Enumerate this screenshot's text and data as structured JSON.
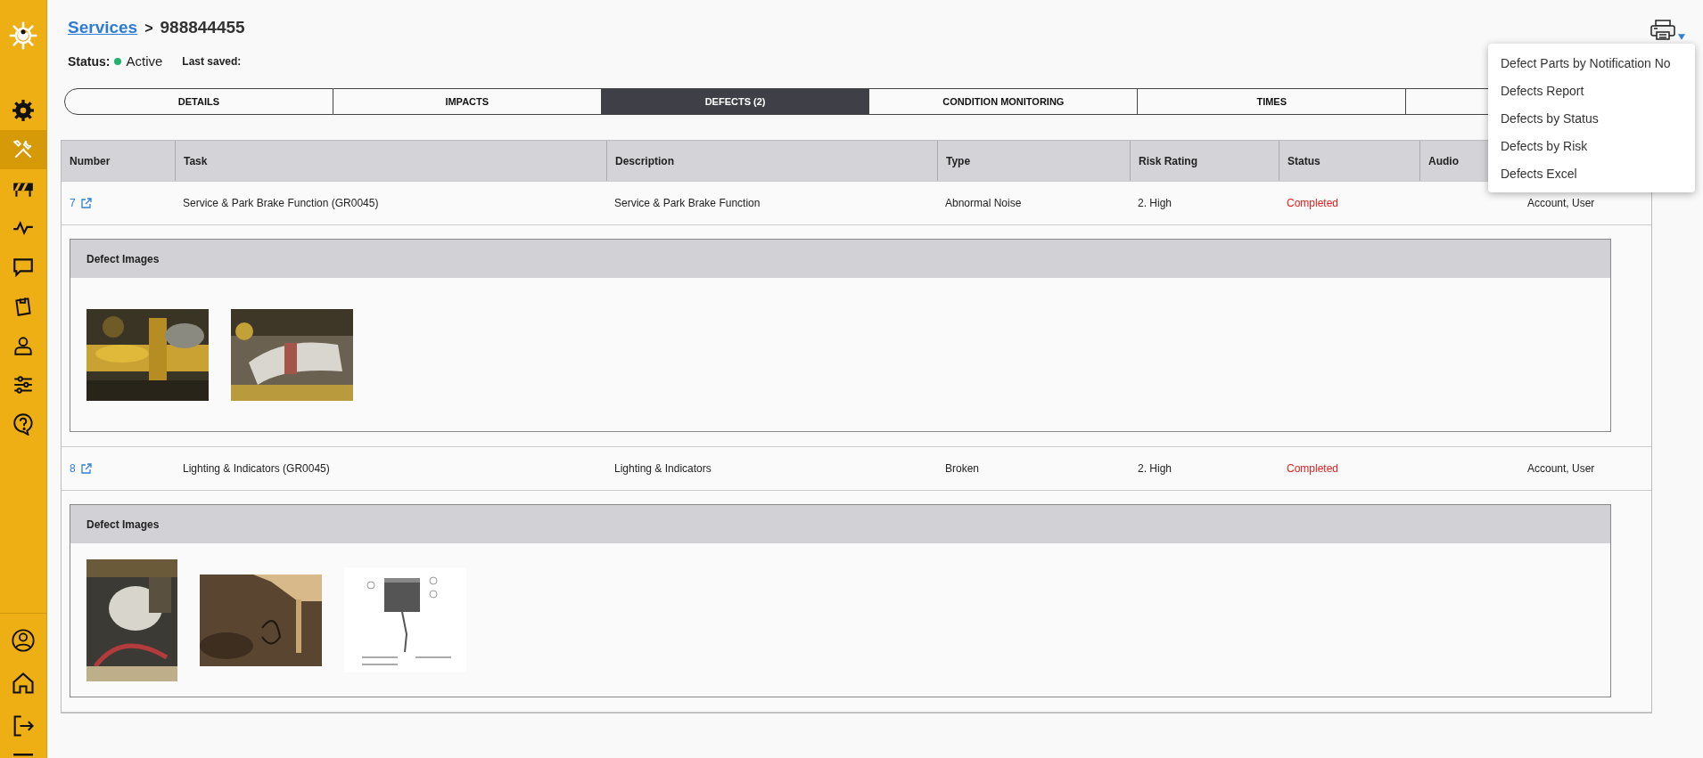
{
  "sidebar": {
    "items": [
      {
        "selected": false
      },
      {
        "selected": true
      },
      {
        "selected": false
      },
      {
        "selected": false
      },
      {
        "selected": false
      },
      {
        "selected": false
      },
      {
        "selected": false
      },
      {
        "selected": false
      },
      {
        "selected": false
      }
    ]
  },
  "breadcrumb": {
    "link": "Services",
    "separator": ">",
    "current": "988844455"
  },
  "status": {
    "label": "Status:",
    "value": "Active",
    "last_saved_label": "Last saved:"
  },
  "tabs": [
    {
      "label": "DETAILS",
      "selected": false
    },
    {
      "label": "IMPACTS",
      "selected": false
    },
    {
      "label": "DEFECTS (2)",
      "selected": true
    },
    {
      "label": "CONDITION MONITORING",
      "selected": false
    },
    {
      "label": "TIMES",
      "selected": false
    },
    {
      "selected": false
    }
  ],
  "print_menu": {
    "items": [
      "Defect Parts by Notification No",
      "Defects Report",
      "Defects by Status",
      "Defects by Risk",
      "Defects Excel"
    ]
  },
  "table": {
    "columns": [
      "Number",
      "Task",
      "Description",
      "Type",
      "Risk Rating",
      "Status",
      "Audio"
    ],
    "rows": [
      {
        "number": "7",
        "task": "Service & Park Brake Function (GR0045)",
        "description": "Service & Park Brake Function",
        "type": "Abnormal Noise",
        "risk_rating": "2. High",
        "status": "Completed",
        "column_8": "Account, User",
        "images_title": "Defect Images"
      },
      {
        "number": "8",
        "task": "Lighting & Indicators (GR0045)",
        "description": "Lighting & Indicators",
        "type": "Broken",
        "risk_rating": "2. High",
        "status": "Completed",
        "column_8": "Account, User",
        "images_title": "Defect Images"
      }
    ]
  }
}
